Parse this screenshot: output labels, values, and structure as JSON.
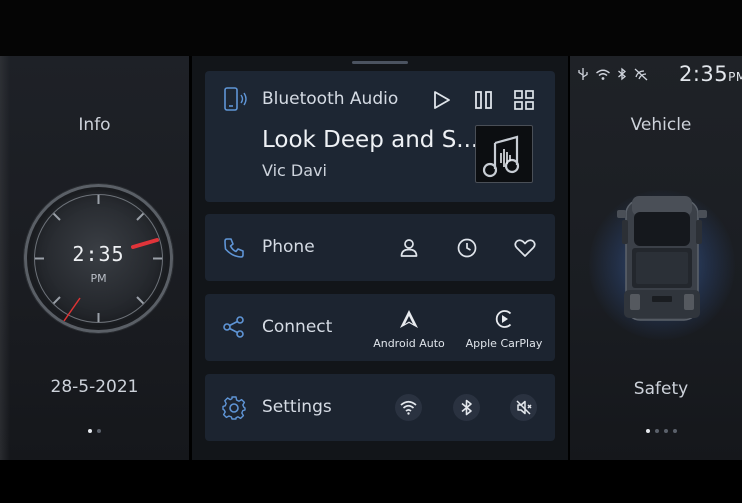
{
  "left_panel": {
    "title": "Info",
    "clock_time": "2:35",
    "clock_ampm": "PM",
    "date": "28-5-2021",
    "page_dots": 2,
    "active_dot": 0
  },
  "media": {
    "source": "Bluetooth Audio",
    "song": "Look Deep and S...",
    "artist": "Vic Davi",
    "controls": [
      "play-icon",
      "pause-icon",
      "grid-icon"
    ]
  },
  "phone": {
    "label": "Phone",
    "actions": [
      "contacts-icon",
      "recent-calls-icon",
      "favorites-icon"
    ]
  },
  "connect": {
    "label": "Connect",
    "android_auto": "Android Auto",
    "apple_carplay": "Apple CarPlay"
  },
  "settings": {
    "label": "Settings",
    "toggles": [
      "wifi-icon",
      "bluetooth-icon",
      "sound-off-icon"
    ]
  },
  "right_panel": {
    "status_time": "2:35",
    "status_ampm": "PM",
    "title": "Vehicle",
    "subtitle": "Safety",
    "page_dots": 4,
    "active_dot": 0
  },
  "colors": {
    "accent_blue": "#5f95d6",
    "card_bg": "#1c2430",
    "clock_hand_red": "#e0343a"
  }
}
